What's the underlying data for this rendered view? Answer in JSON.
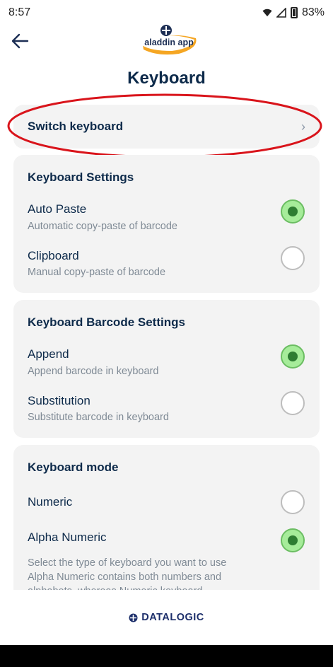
{
  "status_bar": {
    "time": "8:57",
    "battery": "83%"
  },
  "header": {
    "logo_text": "aladdin app",
    "title": "Keyboard"
  },
  "switch_keyboard": {
    "label": "Switch keyboard"
  },
  "keyboard_settings": {
    "title": "Keyboard Settings",
    "options": [
      {
        "title": "Auto Paste",
        "subtitle": "Automatic copy-paste of barcode",
        "selected": true
      },
      {
        "title": "Clipboard",
        "subtitle": "Manual copy-paste of barcode",
        "selected": false
      }
    ]
  },
  "barcode_settings": {
    "title": "Keyboard Barcode Settings",
    "options": [
      {
        "title": "Append",
        "subtitle": "Append barcode in keyboard",
        "selected": true
      },
      {
        "title": "Substitution",
        "subtitle": "Substitute barcode in keyboard",
        "selected": false
      }
    ]
  },
  "keyboard_mode": {
    "title": "Keyboard mode",
    "options": [
      {
        "title": "Numeric",
        "selected": false
      },
      {
        "title": "Alpha Numeric",
        "selected": true
      }
    ],
    "description": "Select the type of keyboard you want to use Alpha Numeric contains both numbers and alphabets, whereas Numeric keyboard"
  },
  "footer": {
    "brand": "DATALOGIC"
  },
  "colors": {
    "accent_green": "#a6ec9a",
    "radio_dot": "#2e7d32",
    "highlight_red": "#d9141b",
    "text_primary": "#0d2a4a"
  }
}
